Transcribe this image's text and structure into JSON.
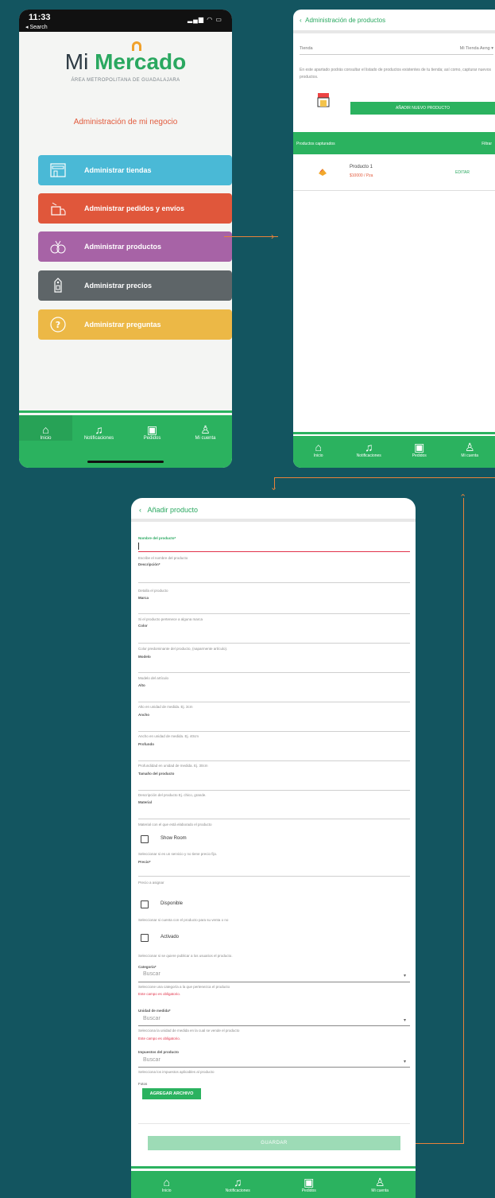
{
  "phone1": {
    "status": {
      "time": "11:33",
      "back": "◂ Search",
      "signal": "▂▄▆ ◠ ▭"
    },
    "logo": {
      "mi": "Mi ",
      "mercado": "Mercado",
      "sub": "ÁREA METROPOLITANA DE GUADALAJARA"
    },
    "section_title": "Administración de mi negocio",
    "buttons": [
      {
        "label": "Administrar tiendas",
        "color": "#4ab9d6",
        "icon": "store-icon"
      },
      {
        "label": "Administrar pedidos y envíos",
        "color": "#e0573b",
        "icon": "delivery-icon"
      },
      {
        "label": "Administrar productos",
        "color": "#a763a6",
        "icon": "products-icon"
      },
      {
        "label": "Administrar precios",
        "color": "#5e6568",
        "icon": "price-tag-icon"
      },
      {
        "label": "Administrar preguntas",
        "color": "#ecb846",
        "icon": "question-icon"
      }
    ],
    "tabs": [
      "Inicio",
      "Notificaciones",
      "Pedidos",
      "Mi cuenta"
    ]
  },
  "phone2": {
    "title": "Administración de productos",
    "store_label": "Tienda",
    "store_value": "Mi Tienda Aeng ▾",
    "description": "En este apartado podrás consultar el listado de productos existentes de tu tienda; así como, capturar nuevos productos.",
    "add_button": "AÑADIR NUEVO PRODUCTO",
    "list_header": "Productos capturados",
    "filter": "Filtrar",
    "product_name": "Producto 1",
    "product_price": "$10000 / Pza",
    "edit": "EDITAR",
    "tabs": [
      "Inicio",
      "Notificaciones",
      "Pedidos",
      "Mi cuenta"
    ]
  },
  "phone3": {
    "title": "Añadir producto",
    "fields": [
      {
        "label": "Nombre del producto*",
        "hint": "Escribe el nombre del producto"
      },
      {
        "label": "Descripción*",
        "hint": "Detalla el producto"
      },
      {
        "label": "Marca",
        "hint": "Si el producto pertenece a alguna marca"
      },
      {
        "label": "Color",
        "hint": "Color predominante del producto, (naparmente artículo)."
      },
      {
        "label": "Modelo",
        "hint": "Modelo del artículo"
      },
      {
        "label": "Alto",
        "hint": "Alto en unidad de medida. Ej. 3cm"
      },
      {
        "label": "Ancho",
        "hint": "Ancho en unidad de medida. Ej. 40cm"
      },
      {
        "label": "Profundo",
        "hint": "Profundidad en unidad de medida. Ej. 30cm"
      },
      {
        "label": "Tamaño del producto",
        "hint": "Descripción del producto Ej. chico, grande."
      },
      {
        "label": "Material",
        "hint": "Material con el que está elaborado el producto"
      }
    ],
    "showroom": {
      "label": "Show Room",
      "hint": "Seleccionar si es un servicio y no tiene precio fijo."
    },
    "price": {
      "label": "Precio*",
      "hint": "Precio a asignar"
    },
    "available": {
      "label": "Disponible",
      "hint": "Seleccionar si cuenta con el producto para su venta o no"
    },
    "active": {
      "label": "Activado",
      "hint": "Seleccionar si se quiere publicar a los usuarios el producto."
    },
    "category": {
      "label": "Categoría*",
      "placeholder": "Buscar",
      "hint": "Seleccione una categoría a la que pertenezca el producto",
      "error": "Este campo es obligatorio."
    },
    "unit": {
      "label": "Unidad de medida*",
      "placeholder": "Buscar",
      "hint": "Selecciona la unidad de medida en la cual se vende el producto",
      "error": "Este campo es obligatorio."
    },
    "taxes": {
      "label": "Impuestos del producto",
      "placeholder": "Buscar",
      "hint": "Selecciona los impuestos aplicables al producto"
    },
    "photo_label": "Fotos",
    "attach_button": "AGREGAR ARCHIVO",
    "save_button": "GUARDAR",
    "tabs": [
      "Inicio",
      "Notificaciones",
      "Pedidos",
      "Mi cuenta"
    ]
  },
  "colors": {
    "green": "#2bb25f",
    "background": "#135560",
    "arrow": "#e8823a"
  }
}
